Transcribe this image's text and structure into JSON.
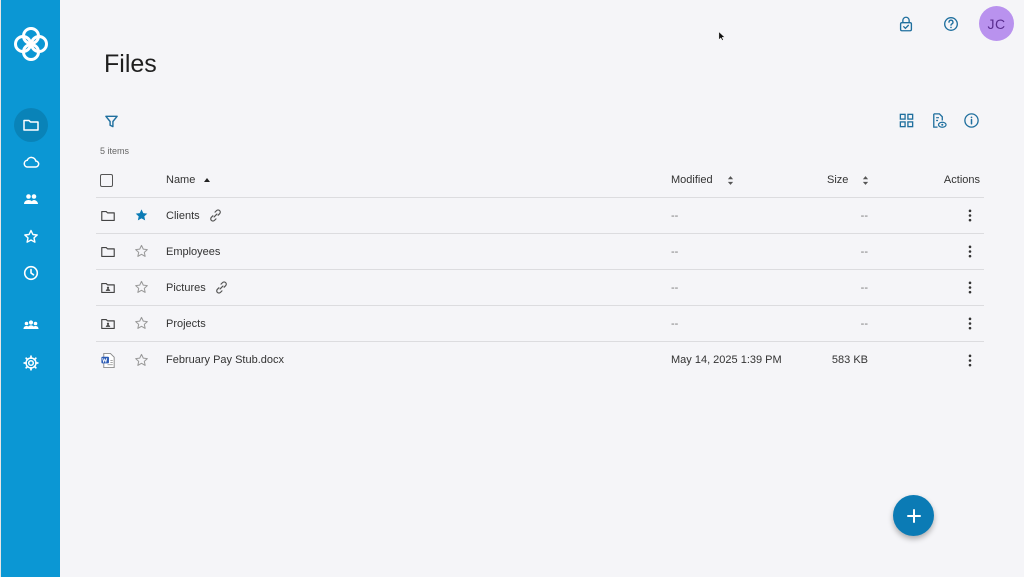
{
  "app": {
    "title": "Files",
    "avatar_initials": "JC",
    "accent_color": "#0b97d4"
  },
  "sidebar": {
    "items": [
      {
        "name": "files",
        "icon": "folder-icon",
        "active": true
      },
      {
        "name": "cloud",
        "icon": "cloud-icon",
        "active": false
      },
      {
        "name": "shared",
        "icon": "users-icon",
        "active": false
      },
      {
        "name": "favorites",
        "icon": "star-icon",
        "active": false
      },
      {
        "name": "recent",
        "icon": "clock-icon",
        "active": false
      },
      {
        "name": "groups",
        "icon": "group-icon",
        "active": false
      },
      {
        "name": "settings",
        "icon": "gear-icon",
        "active": false
      }
    ]
  },
  "toolbar": {
    "item_count": "5 items"
  },
  "table": {
    "headers": {
      "name": "Name",
      "modified": "Modified",
      "size": "Size",
      "actions": "Actions"
    },
    "rows": [
      {
        "name": "Clients",
        "type": "folder",
        "starred": true,
        "shared_link": true,
        "modified": "--",
        "size": "--"
      },
      {
        "name": "Employees",
        "type": "folder",
        "starred": false,
        "shared_link": false,
        "modified": "--",
        "size": "--"
      },
      {
        "name": "Pictures",
        "type": "shared-folder",
        "starred": false,
        "shared_link": true,
        "modified": "--",
        "size": "--"
      },
      {
        "name": "Projects",
        "type": "shared-folder",
        "starred": false,
        "shared_link": false,
        "modified": "--",
        "size": "--"
      },
      {
        "name": "February Pay Stub.docx",
        "type": "word-document",
        "starred": false,
        "shared_link": false,
        "modified": "May 14, 2025 1:39 PM",
        "size": "583 KB"
      }
    ]
  }
}
